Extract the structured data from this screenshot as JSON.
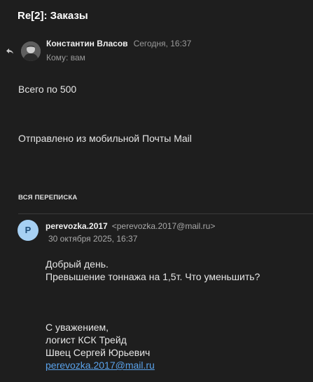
{
  "message": {
    "subject": "Re[2]: Заказы",
    "reply_icon": "reply-arrow-icon",
    "sender": {
      "name": "Константин Власов",
      "time": "Сегодня, 16:37",
      "avatar": "user-photo-avatar"
    },
    "recipient": "Кому: вам",
    "body": {
      "line1": "Всего по 500",
      "signature": "Отправлено из мобильной Почты Mail"
    }
  },
  "thread": {
    "heading": "ВСЯ ПЕРЕПИСКА",
    "quoted": {
      "avatar_letter": "P",
      "avatar_color": "#a6d0f3",
      "sender_name": "perevozka.2017",
      "sender_email": "<perevozka.2017@mail.ru>",
      "date": "30 октября 2025, 16:37",
      "greeting": "Добрый день.",
      "question": "Превышение тоннажа на 1,5т. Что уменьшить?",
      "regards": "С уважением,",
      "position": "логист КСК Трейд",
      "name": "Швец Сергей Юрьевич",
      "email_link": "perevozka.2017@mail.ru",
      "link_color": "#5aa2ea"
    }
  }
}
